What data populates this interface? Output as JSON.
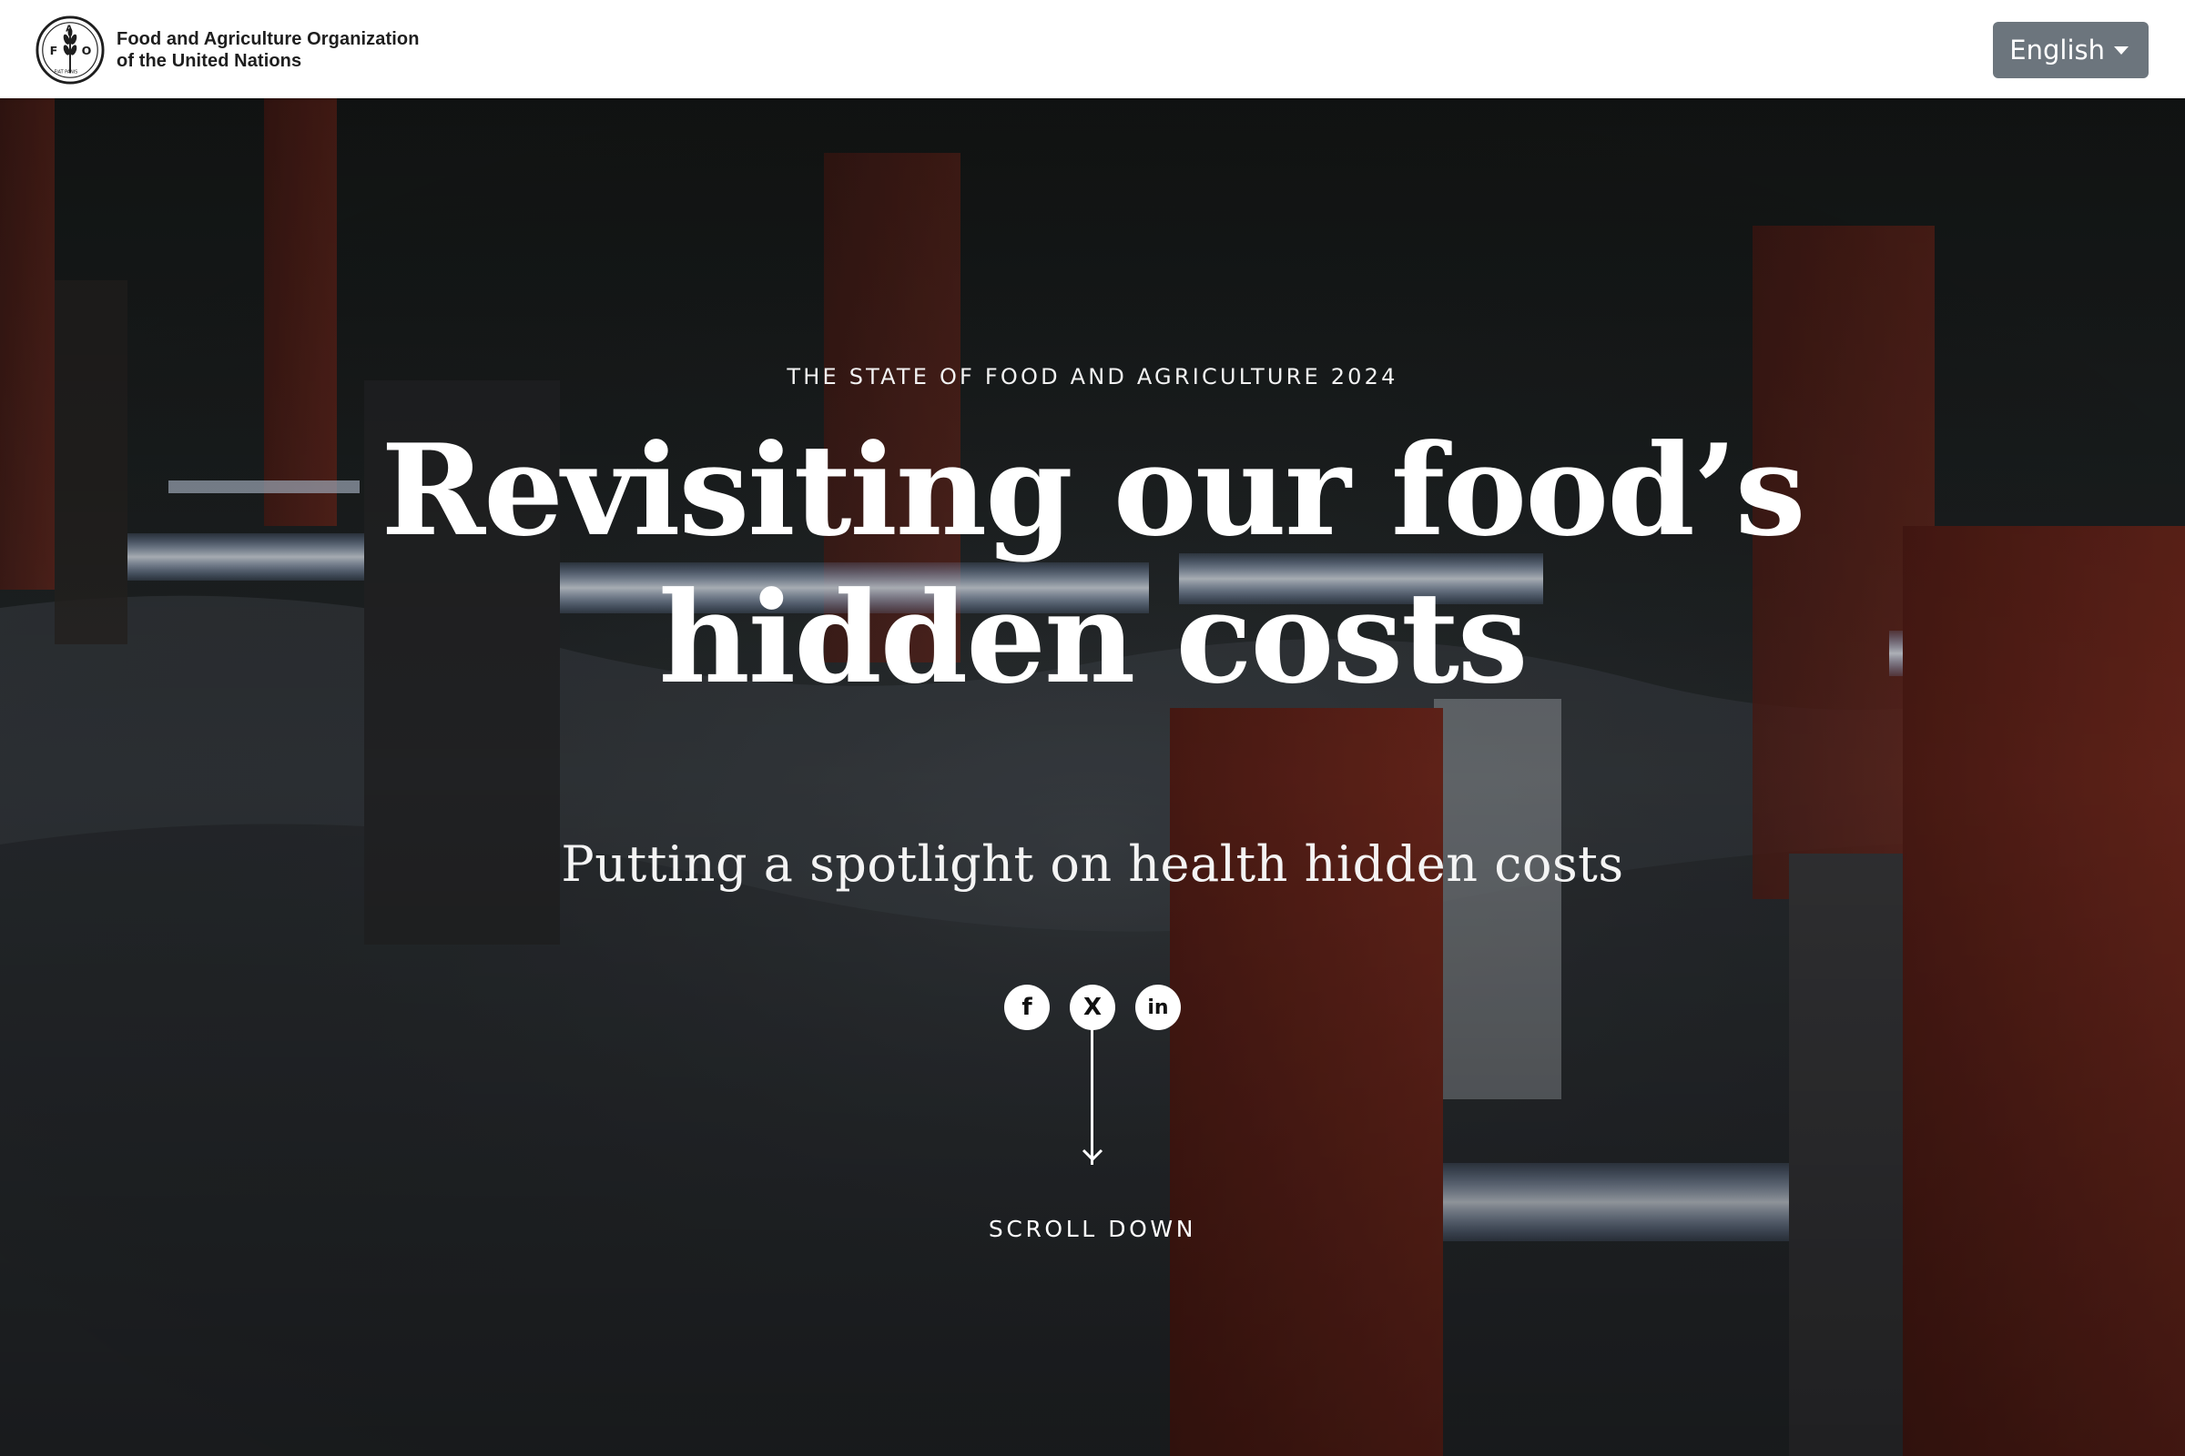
{
  "header": {
    "org_name_line1": "Food and Agriculture Organization",
    "org_name_line2": "of the United Nations",
    "logo_letters": [
      "F",
      "A",
      "O"
    ],
    "logo_motto": "FIAT PANIS",
    "language_label": "English"
  },
  "hero": {
    "kicker": "THE STATE OF FOOD AND AGRICULTURE 2024",
    "title_line1": "Revisiting our food’s",
    "title_line2": "hidden costs",
    "subtitle": "Putting a spotlight on health hidden costs",
    "social": [
      {
        "name": "facebook",
        "glyph": "f"
      },
      {
        "name": "x",
        "glyph": "X"
      },
      {
        "name": "linkedin",
        "glyph": "in"
      }
    ],
    "scroll_label": "SCROLL DOWN"
  },
  "colors": {
    "header_bg": "#ffffff",
    "lang_button_bg": "#6c757d",
    "hero_text": "#ffffff",
    "pillar_red": "#7a2a1e",
    "glow": "#cfe4ff"
  }
}
